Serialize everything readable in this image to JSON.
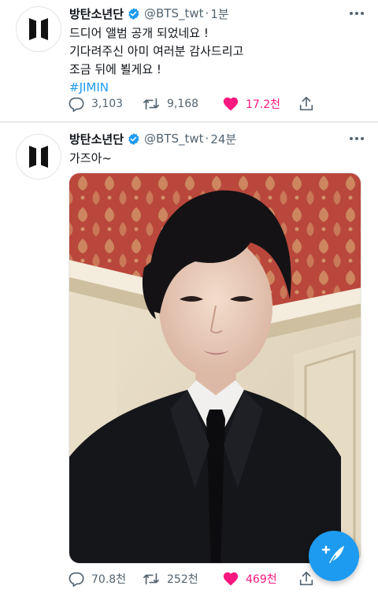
{
  "tweets": [
    {
      "name": "방탄소년단",
      "handle": "@BTS_twt",
      "separator": "·",
      "time": "1분",
      "lines": [
        "드디어 앨범 공개 되었네요 !",
        "기다려주신 아미 여러분 감사드리고",
        "조금 뒤에 뵐게요 !"
      ],
      "hashtag": "#JIMIN",
      "replies": "3,103",
      "retweets": "9,168",
      "likes": "17.2천",
      "liked": true
    },
    {
      "name": "방탄소년단",
      "handle": "@BTS_twt",
      "separator": "·",
      "time": "24분",
      "lines": [
        "가즈아~"
      ],
      "replies": "70.8천",
      "retweets": "252천",
      "likes": "469천",
      "liked": true,
      "has_photo": true
    }
  ],
  "icons": {
    "avatar": "bts-logo-icon",
    "verified": "verified-badge-icon",
    "more": "more-options-icon",
    "reply": "reply-icon",
    "retweet": "retweet-icon",
    "like": "heart-icon",
    "share": "share-icon",
    "compose": "compose-tweet-icon"
  },
  "colors": {
    "accent": "#1d9bf0",
    "like": "#f91880",
    "secondary_text": "#536471"
  }
}
